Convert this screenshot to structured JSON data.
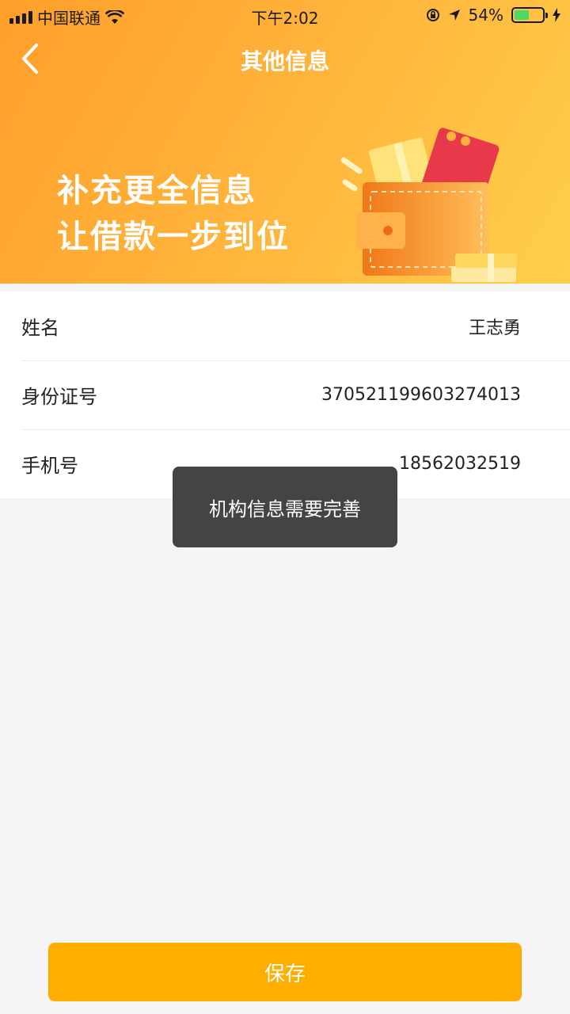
{
  "status_bar": {
    "carrier": "中国联通",
    "time": "下午2:02",
    "battery_percent": "54%",
    "battery_level": 0.54
  },
  "nav": {
    "title": "其他信息",
    "back_icon": "chevron-left-icon"
  },
  "banner": {
    "line1": "补充更全信息",
    "line2": "让借款一步到位"
  },
  "info": {
    "rows": [
      {
        "label": "姓名",
        "value": "王志勇"
      },
      {
        "label": "身份证号",
        "value": "370521199603274013"
      },
      {
        "label": "手机号",
        "value": "18562032519"
      }
    ]
  },
  "toast": {
    "message": "机构信息需要完善"
  },
  "footer": {
    "save_label": "保存"
  },
  "colors": {
    "accent": "#ffae00",
    "header_start": "#ff9f2a",
    "header_end": "#ffcf4a"
  }
}
